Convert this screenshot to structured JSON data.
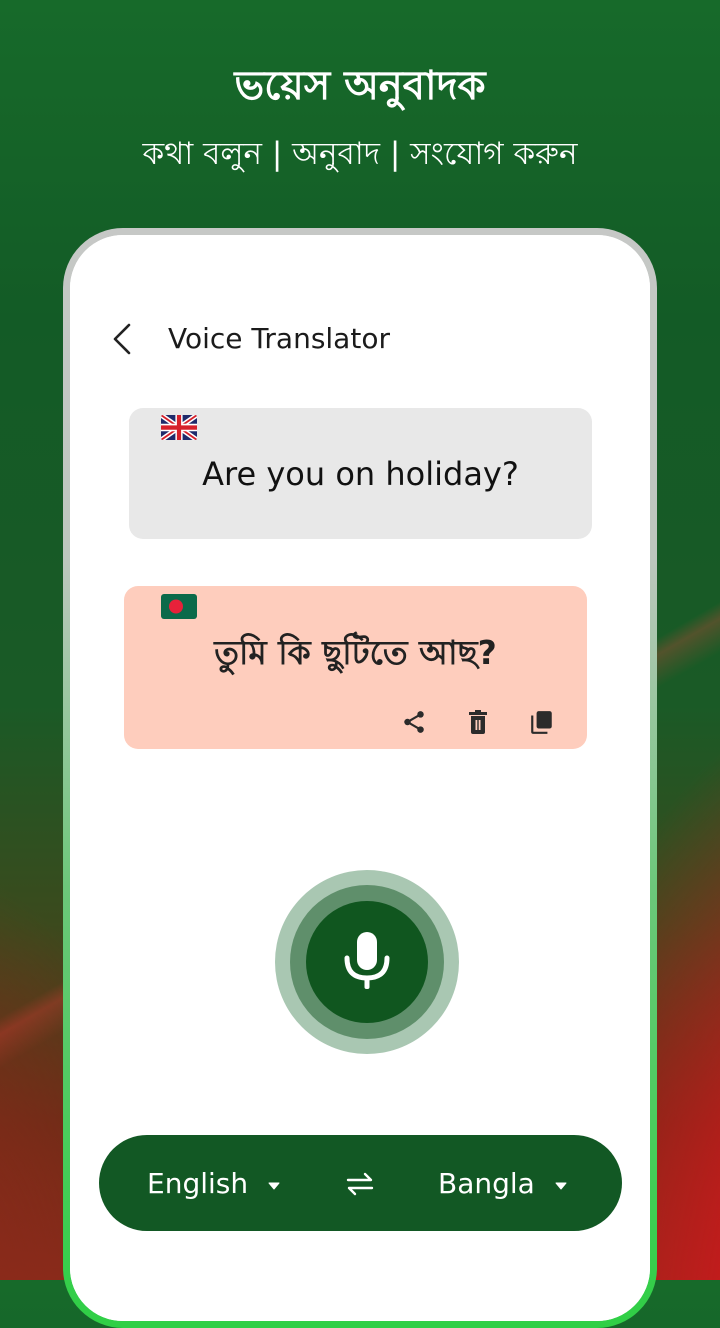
{
  "hero": {
    "title": "ভয়েস অনুবাদক",
    "subtitle": "কথা বলুন | অনুবাদ | সংযোগ করুন"
  },
  "app": {
    "title": "Voice Translator",
    "back_icon": "chevron-left-icon"
  },
  "source_card": {
    "flag": "uk-flag",
    "text": "Are you on holiday?"
  },
  "target_card": {
    "flag": "bangladesh-flag",
    "text": "তুমি কি ছুটিতে আছ?",
    "actions": [
      {
        "name": "share",
        "icon": "share-icon"
      },
      {
        "name": "delete",
        "icon": "trash-icon"
      },
      {
        "name": "copy",
        "icon": "copy-icon"
      }
    ]
  },
  "mic": {
    "icon": "microphone-icon"
  },
  "language_bar": {
    "source_language": "English",
    "target_language": "Bangla",
    "swap_icon": "swap-arrows-icon",
    "dropdown_icon": "caret-down-icon"
  },
  "colors": {
    "brand_green": "#125824",
    "target_card_bg": "#fecdbd",
    "source_card_bg": "#e8e8e8",
    "mic_ring_outer": "#a9c7b2",
    "mic_ring_middle": "#5f8f6b"
  }
}
